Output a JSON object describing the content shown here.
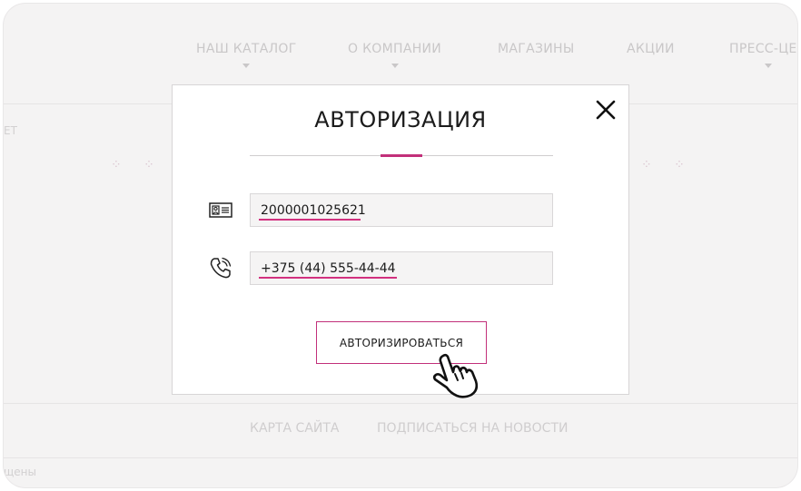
{
  "background": {
    "nav": [
      {
        "label": "НАШ КАТАЛОГ",
        "has_dropdown": true
      },
      {
        "label": "О КОМПАНИИ",
        "has_dropdown": true
      },
      {
        "label": "МАГАЗИНЫ",
        "has_dropdown": false
      },
      {
        "label": "АКЦИИ",
        "has_dropdown": false
      },
      {
        "label": "ПРЕСС-ЦЕН",
        "has_dropdown": true
      }
    ],
    "left_fragment": "ЕТ",
    "footer_links": [
      "КАРТА САЙТА",
      "ПОДПИСАТЬСЯ НА НОВОСТИ"
    ],
    "bottom_fragment": "щены"
  },
  "modal": {
    "title": "АВТОРИЗАЦИЯ",
    "close_icon": "close-icon",
    "fields": [
      {
        "icon": "id-card-icon",
        "value": "2000001025621",
        "type": "text"
      },
      {
        "icon": "phone-icon",
        "value": "+375 (44) 555-44-44",
        "type": "tel"
      }
    ],
    "submit_label": "АВТОРИЗИРОВАТЬСЯ"
  },
  "colors": {
    "accent": "#c2307a",
    "overlay_bg": "#f4f3f3",
    "text": "#1b1b1b"
  },
  "cursor_icon": "hand-pointer-icon"
}
